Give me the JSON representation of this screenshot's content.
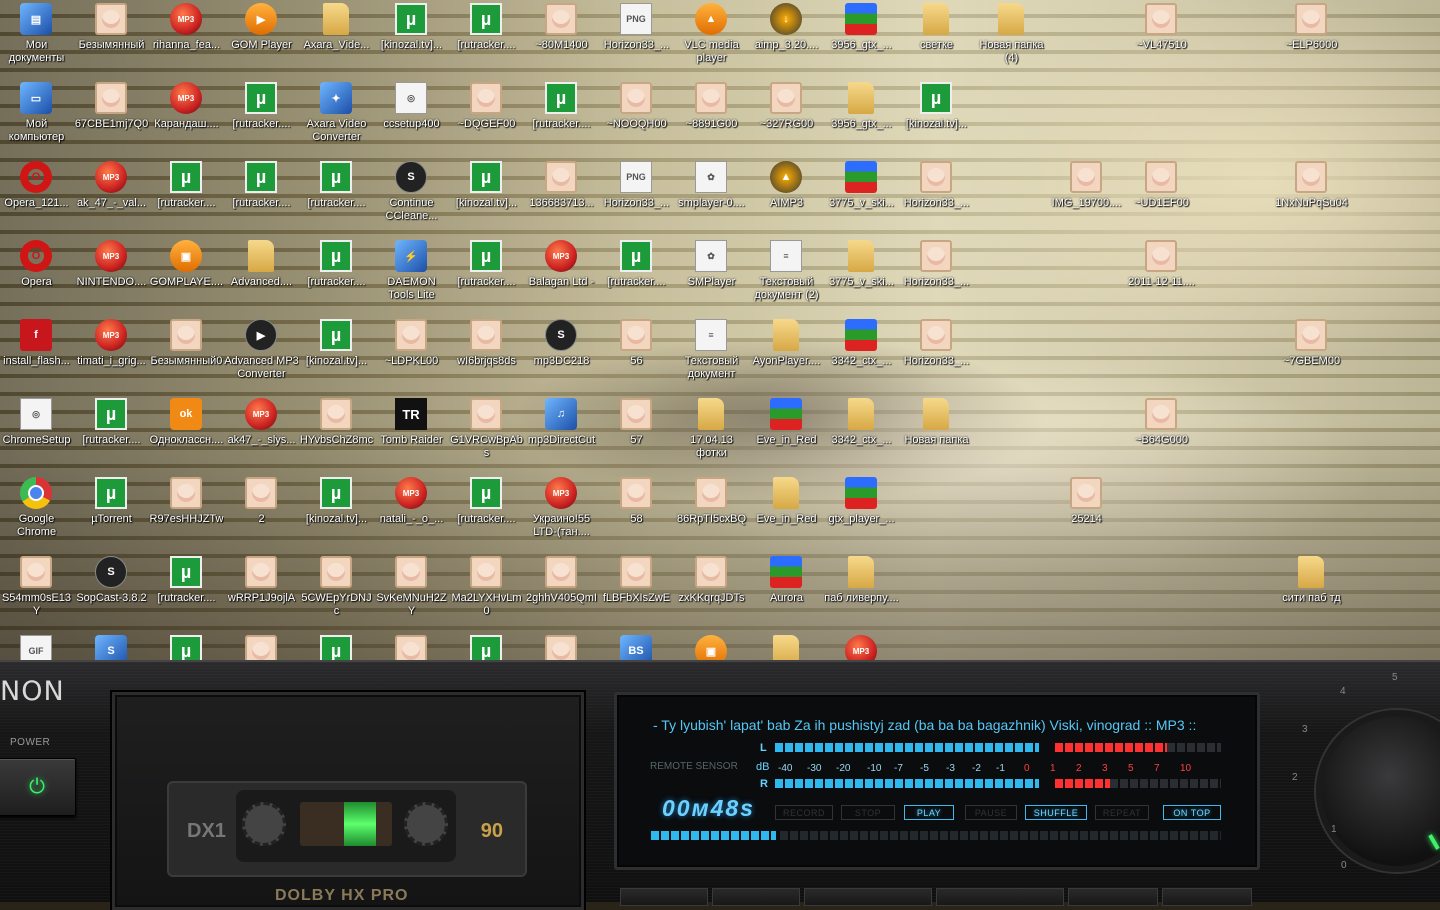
{
  "desktop": {
    "icons": [
      {
        "label": "Мои документы",
        "type": "blue",
        "glyph": "▤"
      },
      {
        "label": "Безымянный",
        "type": "face",
        "glyph": ""
      },
      {
        "label": "rihanna_fea...",
        "type": "mp3",
        "glyph": "MP3"
      },
      {
        "label": "GOM Player",
        "type": "orange",
        "glyph": "▶"
      },
      {
        "label": "Axara_Vide...",
        "type": "folder",
        "glyph": ""
      },
      {
        "label": "[kinozal.tv]...",
        "type": "mu",
        "glyph": "µ"
      },
      {
        "label": "[rutracker....",
        "type": "mu",
        "glyph": "µ"
      },
      {
        "label": "~80M1400",
        "type": "face",
        "glyph": ""
      },
      {
        "label": "Horizon33_...",
        "type": "doc",
        "glyph": "PNG"
      },
      {
        "label": "VLC media player",
        "type": "orange",
        "glyph": "▲"
      },
      {
        "label": "aimp_3.20....",
        "type": "aimp",
        "glyph": "↓"
      },
      {
        "label": "3956_gtx_...",
        "type": "stack",
        "glyph": ""
      },
      {
        "label": "светке",
        "type": "folder",
        "glyph": ""
      },
      {
        "label": "Новая папка (4)",
        "type": "folder",
        "glyph": ""
      },
      {
        "label": "~VL47510",
        "type": "face",
        "glyph": ""
      },
      {
        "label": "~ELP6000",
        "type": "face",
        "glyph": ""
      },
      {
        "label": "Мой компьютер",
        "type": "blue",
        "glyph": "▭"
      },
      {
        "label": "67CBE1mj7Q0",
        "type": "face",
        "glyph": ""
      },
      {
        "label": "Карандаш....",
        "type": "mp3",
        "glyph": "MP3"
      },
      {
        "label": "[rutracker....",
        "type": "mu",
        "glyph": "µ"
      },
      {
        "label": "Axara Video Converter",
        "type": "blue",
        "glyph": "✦"
      },
      {
        "label": "ccsetup400",
        "type": "doc",
        "glyph": "◎"
      },
      {
        "label": "~DQGEF00",
        "type": "face",
        "glyph": ""
      },
      {
        "label": "[rutracker....",
        "type": "mu",
        "glyph": "µ"
      },
      {
        "label": "~NOOQH00",
        "type": "face",
        "glyph": ""
      },
      {
        "label": "~8891G00",
        "type": "face",
        "glyph": ""
      },
      {
        "label": "~327RG00",
        "type": "face",
        "glyph": ""
      },
      {
        "label": "3956_gtx_...",
        "type": "folder",
        "glyph": ""
      },
      {
        "label": "[kinozal.tv]...",
        "type": "mu",
        "glyph": "µ"
      },
      {
        "label": "Opera_121...",
        "type": "opera",
        "glyph": "O"
      },
      {
        "label": "ak_47_-_val...",
        "type": "mp3",
        "glyph": "MP3"
      },
      {
        "label": "[rutracker....",
        "type": "mu",
        "glyph": "µ"
      },
      {
        "label": "[rutracker....",
        "type": "mu",
        "glyph": "µ"
      },
      {
        "label": "[rutracker....",
        "type": "mu",
        "glyph": "µ"
      },
      {
        "label": "Continue CCleane...",
        "type": "dark",
        "glyph": "S"
      },
      {
        "label": "[kinozal.tv]...",
        "type": "mu",
        "glyph": "µ"
      },
      {
        "label": "136683713...",
        "type": "face",
        "glyph": ""
      },
      {
        "label": "Horizon33_...",
        "type": "doc",
        "glyph": "PNG"
      },
      {
        "label": "smplayer-0....",
        "type": "doc",
        "glyph": "✿"
      },
      {
        "label": "AIMP3",
        "type": "aimp",
        "glyph": "▲"
      },
      {
        "label": "3775_v_ski...",
        "type": "stack",
        "glyph": ""
      },
      {
        "label": "Horizon33_...",
        "type": "face",
        "glyph": ""
      },
      {
        "label": "IMG_19700....",
        "type": "face",
        "glyph": ""
      },
      {
        "label": "~UD1EF00",
        "type": "face",
        "glyph": ""
      },
      {
        "label": "1NxNuPqSu04",
        "type": "face",
        "glyph": ""
      },
      {
        "label": "Opera",
        "type": "opera",
        "glyph": "O"
      },
      {
        "label": "NINTENDO....",
        "type": "mp3",
        "glyph": "MP3"
      },
      {
        "label": "GOMPLAYE....",
        "type": "orange",
        "glyph": "▣"
      },
      {
        "label": "Advanced....",
        "type": "folder",
        "glyph": ""
      },
      {
        "label": "[rutracker....",
        "type": "mu",
        "glyph": "µ"
      },
      {
        "label": "DAEMON Tools Lite",
        "type": "blue",
        "glyph": "⚡"
      },
      {
        "label": "[rutracker....",
        "type": "mu",
        "glyph": "µ"
      },
      {
        "label": "Balagan Ltd -",
        "type": "mp3",
        "glyph": "MP3"
      },
      {
        "label": "[rutracker....",
        "type": "mu",
        "glyph": "µ"
      },
      {
        "label": "SMPlayer",
        "type": "doc",
        "glyph": "✿"
      },
      {
        "label": "Текстовый документ (2)",
        "type": "doc",
        "glyph": "≡"
      },
      {
        "label": "3775_v_ski...",
        "type": "folder",
        "glyph": ""
      },
      {
        "label": "Horizon33_...",
        "type": "face",
        "glyph": ""
      },
      {
        "label": "2011-12-11....",
        "type": "face",
        "glyph": ""
      },
      {
        "label": "install_flash...",
        "type": "flash",
        "glyph": "f"
      },
      {
        "label": "timati_i_grig...",
        "type": "mp3",
        "glyph": "MP3"
      },
      {
        "label": "Безымянный0",
        "type": "face",
        "glyph": ""
      },
      {
        "label": "Advanced MP3 Converter",
        "type": "dark",
        "glyph": "▶"
      },
      {
        "label": "[kinozal.tv]...",
        "type": "mu",
        "glyph": "µ"
      },
      {
        "label": "~LDPKL00",
        "type": "face",
        "glyph": ""
      },
      {
        "label": "wI6brjqs8ds",
        "type": "face",
        "glyph": ""
      },
      {
        "label": "mp3DC218",
        "type": "dark",
        "glyph": "S"
      },
      {
        "label": "56",
        "type": "face",
        "glyph": ""
      },
      {
        "label": "Текстовый документ",
        "type": "doc",
        "glyph": "≡"
      },
      {
        "label": "AyonPlayer....",
        "type": "folder",
        "glyph": ""
      },
      {
        "label": "3342_ctx_...",
        "type": "stack",
        "glyph": ""
      },
      {
        "label": "Horizon33_...",
        "type": "face",
        "glyph": ""
      },
      {
        "label": "~7GBEM00",
        "type": "face",
        "glyph": ""
      },
      {
        "label": "ChromeSetup",
        "type": "doc",
        "glyph": "◎"
      },
      {
        "label": "[rutracker....",
        "type": "mu",
        "glyph": "µ"
      },
      {
        "label": "Одноклассн....",
        "type": "ok",
        "glyph": "ok"
      },
      {
        "label": "ak47_-_slys...",
        "type": "mp3",
        "glyph": "MP3"
      },
      {
        "label": "HYvbsChZ8mc",
        "type": "face",
        "glyph": ""
      },
      {
        "label": "Tomb Raider",
        "type": "tr",
        "glyph": "TR"
      },
      {
        "label": "G1VRCwBpAbs",
        "type": "face",
        "glyph": ""
      },
      {
        "label": "mp3DirectCut",
        "type": "blue",
        "glyph": "♫"
      },
      {
        "label": "57",
        "type": "face",
        "glyph": ""
      },
      {
        "label": "17.04.13 фотки",
        "type": "folder",
        "glyph": ""
      },
      {
        "label": "Eve_in_Red",
        "type": "stack",
        "glyph": ""
      },
      {
        "label": "3342_ctx_...",
        "type": "folder",
        "glyph": ""
      },
      {
        "label": "Новая папка",
        "type": "folder",
        "glyph": ""
      },
      {
        "label": "~B64G000",
        "type": "face",
        "glyph": ""
      },
      {
        "label": "Google Chrome",
        "type": "chrome",
        "glyph": ""
      },
      {
        "label": "µTorrent",
        "type": "mu",
        "glyph": "µ"
      },
      {
        "label": "R97esHHJZTw",
        "type": "face",
        "glyph": ""
      },
      {
        "label": "2",
        "type": "face",
        "glyph": ""
      },
      {
        "label": "[kinozal.tv]...",
        "type": "mu",
        "glyph": "µ"
      },
      {
        "label": "natali_-_o_...",
        "type": "mp3",
        "glyph": "MP3"
      },
      {
        "label": "[rutracker....",
        "type": "mu",
        "glyph": "µ"
      },
      {
        "label": "Украино!55 LTD-(тан....",
        "type": "mp3",
        "glyph": "MP3"
      },
      {
        "label": "58",
        "type": "face",
        "glyph": ""
      },
      {
        "label": "86RpTI5cxBQ",
        "type": "face",
        "glyph": ""
      },
      {
        "label": "Eve_in_Red",
        "type": "folder",
        "glyph": ""
      },
      {
        "label": "gtx_player_...",
        "type": "stack",
        "glyph": ""
      },
      {
        "label": "25214",
        "type": "face",
        "glyph": ""
      },
      {
        "label": "S54mm0sE13Y",
        "type": "face",
        "glyph": ""
      },
      {
        "label": "SopCast-3.8.2",
        "type": "dark",
        "glyph": "S"
      },
      {
        "label": "[rutracker....",
        "type": "mu",
        "glyph": "µ"
      },
      {
        "label": "wRRP1J9ojlA",
        "type": "face",
        "glyph": ""
      },
      {
        "label": "5CWEpYrDNJc",
        "type": "face",
        "glyph": ""
      },
      {
        "label": "SvKeMNuH2ZY",
        "type": "face",
        "glyph": ""
      },
      {
        "label": "Ma2LYXHvLm0",
        "type": "face",
        "glyph": ""
      },
      {
        "label": "2ghhV405QmI",
        "type": "face",
        "glyph": ""
      },
      {
        "label": "fLBFbXIsZwE",
        "type": "face",
        "glyph": ""
      },
      {
        "label": "zxKKqrqJDTs",
        "type": "face",
        "glyph": ""
      },
      {
        "label": "Aurora",
        "type": "stack",
        "glyph": ""
      },
      {
        "label": "паб ливерпу....",
        "type": "folder",
        "glyph": ""
      },
      {
        "label": "сити паб тд",
        "type": "folder",
        "glyph": ""
      },
      {
        "label": "",
        "type": "doc",
        "glyph": "GIF"
      },
      {
        "label": "",
        "type": "blue",
        "glyph": "S"
      },
      {
        "label": "",
        "type": "mu",
        "glyph": "µ"
      },
      {
        "label": "",
        "type": "face",
        "glyph": ""
      },
      {
        "label": "",
        "type": "mu",
        "glyph": "µ"
      },
      {
        "label": "",
        "type": "face",
        "glyph": ""
      },
      {
        "label": "",
        "type": "mu",
        "glyph": "µ"
      },
      {
        "label": "",
        "type": "face",
        "glyph": ""
      },
      {
        "label": "",
        "type": "blue",
        "glyph": "BS"
      },
      {
        "label": "",
        "type": "orange",
        "glyph": "▣"
      },
      {
        "label": "",
        "type": "folder",
        "glyph": ""
      },
      {
        "label": "",
        "type": "mp3",
        "glyph": "MP3"
      }
    ]
  },
  "player": {
    "brand": "NON",
    "power_label": "POWER",
    "power_icon": "⏻",
    "cassette_model": "DX1",
    "cassette_length": "90",
    "dolby_label": "DOLBY HX PRO",
    "song_title": "- Ty lyubish' lapat' bab Za ih pushistyj zad (ba ba ba bagazhnik) Viski, vinograd :: MP3 ::",
    "remote_sensor_label": "REMOTE SENSOR",
    "left_channel": "L",
    "right_channel": "R",
    "db_label": "dB",
    "db_ticks": [
      "-40",
      "-30",
      "-20",
      "-10",
      "-7",
      "-5",
      "-3",
      "-2",
      "-1",
      "0",
      "1",
      "2",
      "3",
      "5",
      "7",
      "10"
    ],
    "left_level": 0.88,
    "right_level": 0.75,
    "time": "00м48s",
    "buttons": [
      {
        "label": "RECORD",
        "active": false
      },
      {
        "label": "STOP",
        "active": false
      },
      {
        "label": "PLAY",
        "active": true
      },
      {
        "label": "PAUSE",
        "active": false
      },
      {
        "label": "SHUFFLE",
        "active": true
      },
      {
        "label": "REPEAT",
        "active": false
      },
      {
        "label": "ON TOP",
        "active": true
      }
    ],
    "progress": 0.22,
    "knob_scale": [
      "0",
      "1",
      "2",
      "3",
      "4",
      "5"
    ],
    "colors": {
      "display_accent": "#56c7f5",
      "vu_red": "#ff3030",
      "power_green": "#3ef06a"
    }
  }
}
